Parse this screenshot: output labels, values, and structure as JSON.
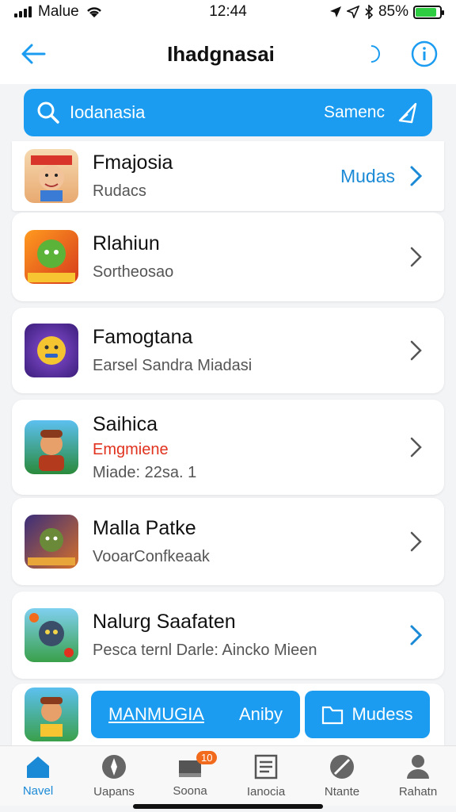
{
  "status_bar": {
    "carrier": "Malue",
    "time": "12:44",
    "battery_pct": "85%",
    "battery_level": 0.85
  },
  "header": {
    "title": "Ihadgnasai",
    "back_icon": "back-arrow-icon",
    "moon_icon": "moon-icon",
    "info_icon": "info-icon"
  },
  "search": {
    "value": "Iodanasia",
    "action_label": "Samenc",
    "send_icon": "send-icon"
  },
  "colors": {
    "accent": "#1b9cf0",
    "link": "#1b8ad6",
    "badge": "#f26b1d",
    "promo_red": "#e0321e"
  },
  "list": {
    "items": [
      {
        "title": "Fmajosia",
        "subtitle": "Rudacs",
        "link": "Mudas"
      },
      {
        "title": "Rlahiun",
        "subtitle": "Sortheosao"
      },
      {
        "title": "Famogtana",
        "subtitle": "Earsel Sandra Miadasi"
      },
      {
        "title": "Saihica",
        "promo": "Emgmiene",
        "subtitle": "Miade: 22sa. 1"
      },
      {
        "title": "Malla Patke",
        "subtitle": "VooarConfkeaak"
      },
      {
        "title": "Nalurg Saafaten",
        "subtitle": "Pesca ternl Darle: Aincko Mieen"
      }
    ]
  },
  "bottom_actions": {
    "primary_label": "MANMUGIA",
    "secondary_label": "Aniby",
    "mudess_label": "Mudess"
  },
  "tabbar": {
    "tabs": [
      {
        "label": "Navel",
        "icon": "home-icon",
        "active": true
      },
      {
        "label": "Uapans",
        "icon": "compass-icon"
      },
      {
        "label": "Soona",
        "icon": "inbox-icon",
        "badge": "10"
      },
      {
        "label": "Ianocia",
        "icon": "document-icon"
      },
      {
        "label": "Ntante",
        "icon": "blocked-icon"
      },
      {
        "label": "Rahatn",
        "icon": "person-icon"
      }
    ]
  }
}
